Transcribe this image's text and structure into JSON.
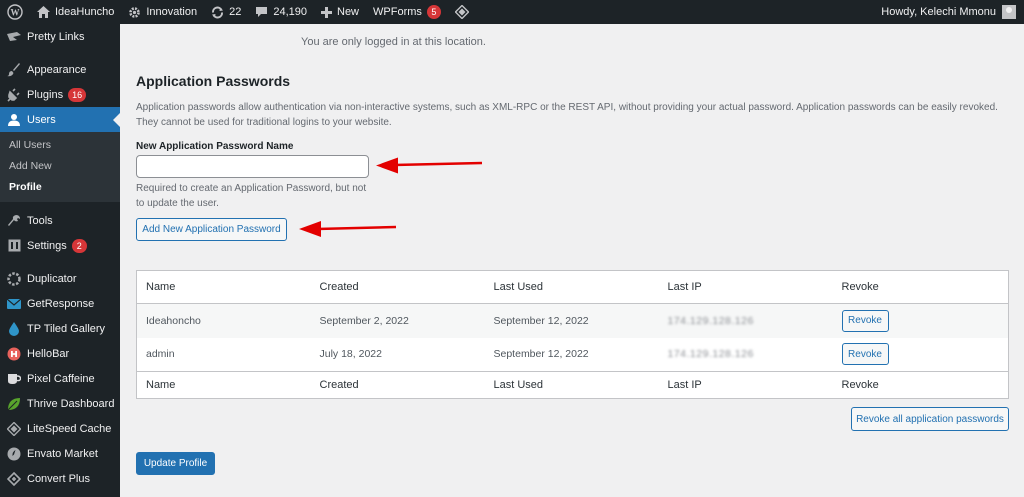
{
  "adminbar": {
    "site_name": "IdeaHuncho",
    "customizer_label": "Innovation",
    "updates_count": "22",
    "comments_count": "24,190",
    "new_label": "New",
    "wpforms_label": "WPForms",
    "wpforms_badge": "5",
    "greeting": "Howdy, Kelechi Mmonu"
  },
  "sidebar": {
    "items_top": [
      {
        "label": "Pretty Links",
        "icon": "star-icon"
      },
      {
        "label": "Appearance",
        "icon": "paintbrush-icon"
      },
      {
        "label": "Plugins",
        "icon": "plugin-icon",
        "badge": "16"
      },
      {
        "label": "Users",
        "icon": "users-icon",
        "current": true
      }
    ],
    "users_submenu": [
      "All Users",
      "Add New",
      "Profile"
    ],
    "items_bottom": [
      {
        "label": "Tools",
        "icon": "wrench-icon"
      },
      {
        "label": "Settings",
        "icon": "settings-icon",
        "badge": "2"
      },
      {
        "label": "Duplicator",
        "icon": "duplicator-icon"
      },
      {
        "label": "GetResponse",
        "icon": "mail-icon"
      },
      {
        "label": "TP Tiled Gallery",
        "icon": "drop-icon"
      },
      {
        "label": "HelloBar",
        "icon": "hellobar-icon"
      },
      {
        "label": "Pixel Caffeine",
        "icon": "cup-icon"
      },
      {
        "label": "Thrive Dashboard",
        "icon": "leaf-icon"
      },
      {
        "label": "LiteSpeed Cache",
        "icon": "diamond-icon"
      },
      {
        "label": "Envato Market",
        "icon": "envato-icon"
      },
      {
        "label": "Convert Plus",
        "icon": "convert-icon"
      }
    ]
  },
  "main": {
    "location_note": "You are only logged in at this location.",
    "heading": "Application Passwords",
    "description": "Application passwords allow authentication via non-interactive systems, such as XML-RPC or the REST API, without providing your actual password. Application passwords can be easily revoked. They cannot be used for traditional logins to your website.",
    "field_label": "New Application Password Name",
    "field_value": "",
    "field_help": "Required to create an Application Password, but not to update the user.",
    "add_button": "Add New Application Password",
    "table": {
      "columns": [
        "Name",
        "Created",
        "Last Used",
        "Last IP",
        "Revoke"
      ],
      "rows": [
        {
          "name": "Ideahoncho",
          "created": "September 2, 2022",
          "last_used": "September 12, 2022",
          "last_ip": "174.129.128.126",
          "revoke": "Revoke"
        },
        {
          "name": "admin",
          "created": "July 18, 2022",
          "last_used": "September 12, 2022",
          "last_ip": "174.129.128.126",
          "revoke": "Revoke"
        }
      ]
    },
    "revoke_all_button": "Revoke all application passwords",
    "update_button": "Update Profile"
  },
  "colors": {
    "admin_dark": "#1d2327",
    "accent_blue": "#2271b1",
    "badge_red": "#d63638",
    "arrow_red": "#e30000"
  }
}
